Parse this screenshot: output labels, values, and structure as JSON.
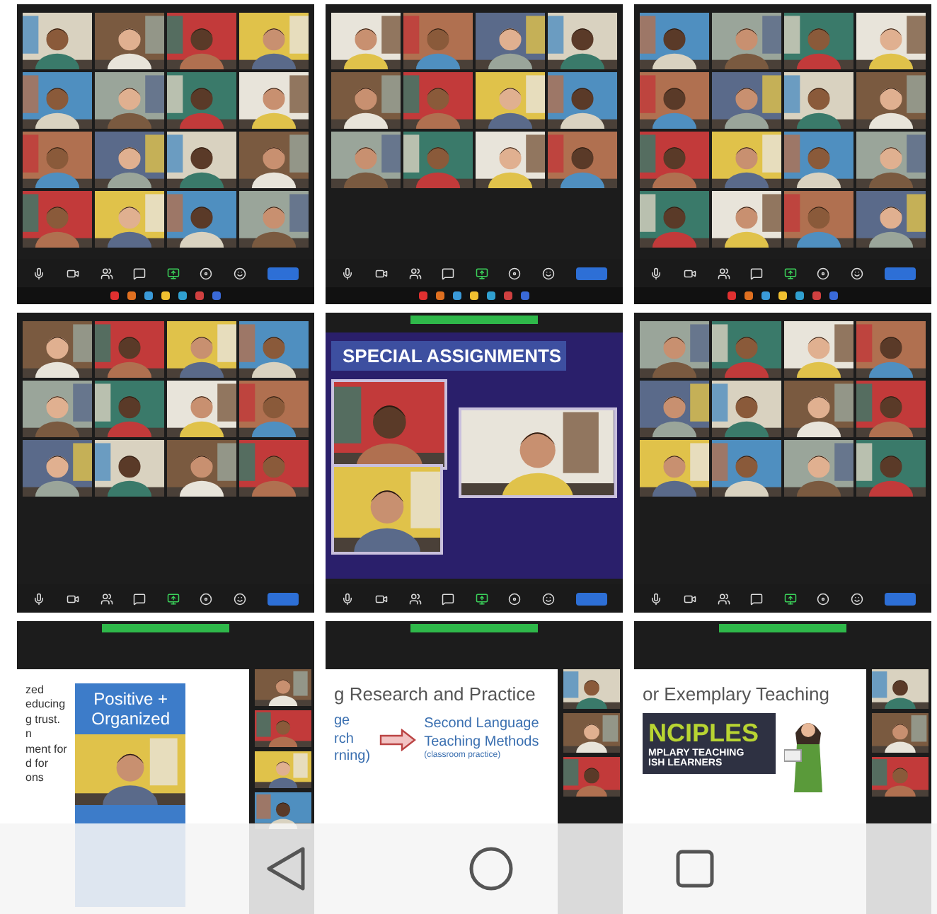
{
  "screens": [
    {
      "kind": "gallery"
    },
    {
      "kind": "gallery"
    },
    {
      "kind": "gallery"
    },
    {
      "kind": "gallery"
    },
    {
      "kind": "photo_slide",
      "title": "SPECIAL ASSIGNMENTS"
    },
    {
      "kind": "gallery"
    },
    {
      "kind": "text_slide",
      "lines": [
        "zed",
        "educing",
        "g trust.",
        "n",
        "ment for",
        "d for",
        "ons"
      ],
      "card": "Positive + Organized"
    },
    {
      "kind": "arrow_slide",
      "title": "g Research and Practice",
      "left": [
        "ge",
        "rch",
        "rning)"
      ],
      "right": [
        "Second Language",
        "Teaching Methods"
      ],
      "right_note": "(classroom practice)"
    },
    {
      "kind": "banner_slide",
      "title": "or Exemplary Teaching",
      "banner": [
        "NCIPLES",
        "MPLARY TEACHING",
        "ISH LEARNERS"
      ]
    }
  ]
}
